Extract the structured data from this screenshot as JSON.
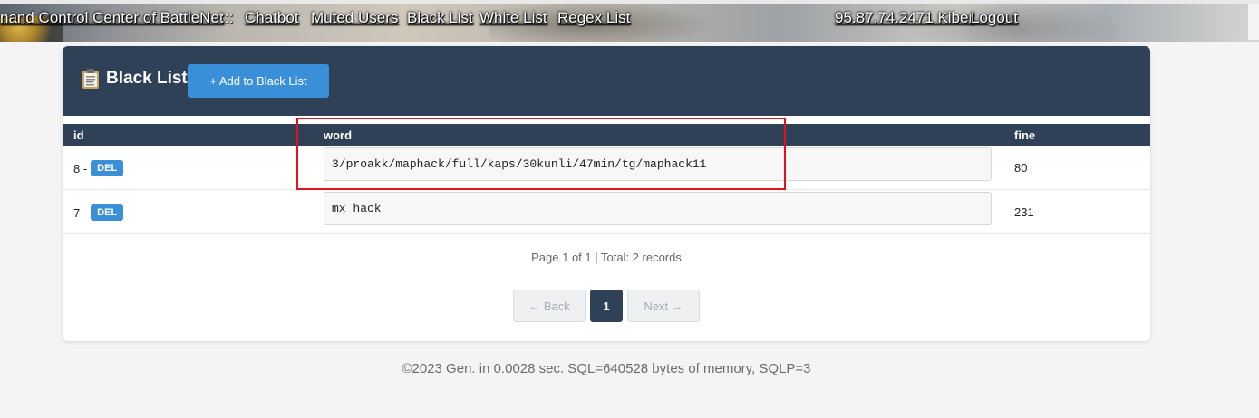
{
  "nav": {
    "title": "nand Control Center of BattleNet",
    "sep": ":::",
    "links": [
      "Chatbot",
      "Muted Users",
      "Black List",
      "White List",
      "Regex List"
    ],
    "user": "95.87.74.2471 Kiber",
    "logout": "Logout"
  },
  "card": {
    "title": "Black List",
    "add_button": "+ Add to Black List",
    "columns": {
      "id": "id",
      "word": "word",
      "fine": "fine"
    },
    "rows": [
      {
        "id": "8 -",
        "del": "DEL",
        "word": "3/proakk/maphack/full/kaps/30kunli/47min/tg/maphack11",
        "fine": "80"
      },
      {
        "id": "7 -",
        "del": "DEL",
        "word": "mx hack",
        "fine": "231"
      }
    ],
    "page_info": "Page 1 of 1 | Total: 2 records",
    "pagination": {
      "back": "← Back",
      "current": "1",
      "next": "Next →"
    }
  },
  "footer": "©2023 Gen. in 0.0028 sec. SQL=640528 bytes of memory, SQLP=3",
  "colors": {
    "header": "#2f4157",
    "accent": "#3a8fd9",
    "highlight": "#e0121d"
  },
  "icons": {
    "title_icon": "clipboard-icon"
  }
}
